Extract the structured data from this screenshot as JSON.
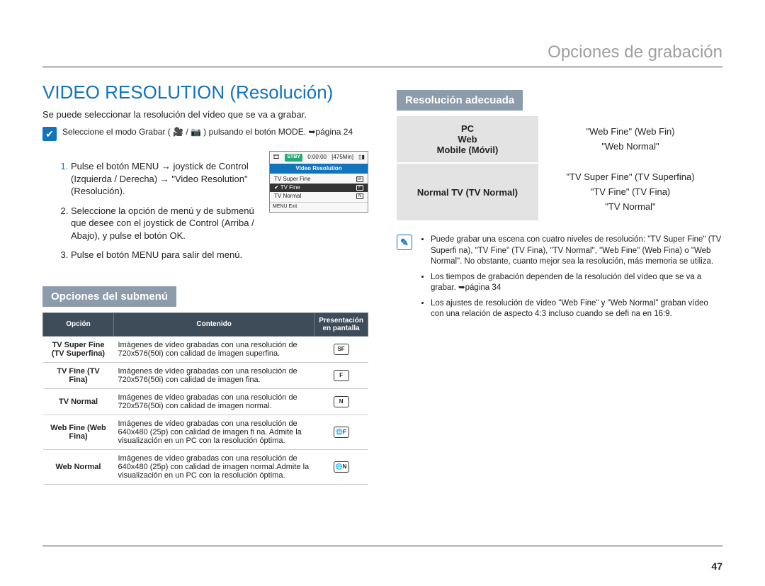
{
  "header": {
    "chapter": "Opciones de grabación"
  },
  "left": {
    "title": "VIDEO RESOLUTION (Resolución)",
    "intro": "Se puede seleccionar la resolución del vídeo que se va a grabar.",
    "mode_note": "Seleccione el modo Grabar ( 🎥 / 📷 ) pulsando el botón MODE. ➥página 24",
    "steps": [
      "Pulse el botón MENU → joystick de Control (Izquierda / Derecha) → \"Video Resolution\" (Resolución).",
      "Seleccione la opción de menú y de submenú que desee con el joystick de Control (Arriba / Abajo), y pulse el botón OK.",
      "Pulse el botón MENU para salir del menú."
    ],
    "lcd": {
      "stby": "STBY",
      "time": "0:00:00",
      "remain": "[475Min]",
      "menu_title": "Video Resolution",
      "items": [
        "TV Super Fine",
        "TV Fine",
        "TV Normal"
      ],
      "selected_index": 1,
      "footer": "MENU Exit"
    },
    "submenu_title": "Opciones del submenú",
    "options_headers": [
      "Opción",
      "Contenido",
      "Presentación en pantalla"
    ],
    "options": [
      {
        "name": "TV Super Fine (TV Superfina)",
        "desc": "Imágenes de vídeo grabadas con una resolución de 720x576(50i) con calidad de imagen superfina.",
        "pres": "SF"
      },
      {
        "name": "TV Fine (TV Fina)",
        "desc": "Imágenes de vídeo grabadas con una resolución de 720x576(50i) con calidad de imagen fina.",
        "pres": "F"
      },
      {
        "name": "TV Normal",
        "desc": "Imágenes de vídeo grabadas con una resolución de 720x576(50i) con calidad de imagen normal.",
        "pres": "N"
      },
      {
        "name": "Web Fine (Web Fina)",
        "desc": "Imágenes de vídeo grabadas con una resolución de 640x480 (25p) con calidad de imagen fi na. Admite la visualización en un PC con la resolución óptima.",
        "pres": "🌐F"
      },
      {
        "name": "Web Normal",
        "desc": "Imágenes de vídeo grabadas con una resolución de 640x480 (25p) con calidad de imagen normal.Admite la visualización en un PC con la resolución óptima.",
        "pres": "🌐N"
      }
    ]
  },
  "right": {
    "title": "Resolución adecuada",
    "rows": [
      {
        "cat": "PC\nWeb\nMobile (Móvil)",
        "val": "\"Web Fine\" (Web Fin)\n\"Web Normal\""
      },
      {
        "cat": "Normal TV (TV Normal)",
        "val": "\"TV Super Fine\" (TV Superfina)\n\"TV Fine\" (TV Fina)\n\"TV Normal\""
      }
    ],
    "notes": [
      "Puede grabar una escena con cuatro niveles de resolución: \"TV Super Fine\" (TV Superfi na), \"TV Fine\" (TV Fina), \"TV Normal\", \"Web Fine\" (Web Fina) o \"Web Normal\". No obstante, cuanto mejor sea la resolución, más memoria se utiliza.",
      "Los tiempos de grabación dependen de la resolución del vídeo que se va a grabar. ➥página 34",
      "Los ajustes de resolución de vídeo \"Web Fine\" y \"Web Normal\" graban vídeo con una relación de aspecto 4:3 incluso cuando se defi na en 16:9."
    ]
  },
  "page_number": "47"
}
